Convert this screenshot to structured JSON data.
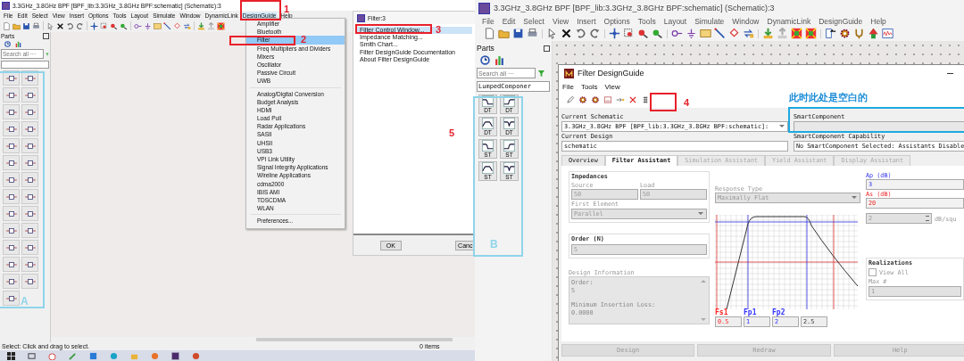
{
  "left": {
    "title": "3.3GHz_3.8GHz BPF [BPF_lib:3.3GHz_3.8GHz BPF:schematic] (Schematic):3",
    "menu": [
      {
        "label": "File",
        "selected": false
      },
      {
        "label": "Edit",
        "selected": false
      },
      {
        "label": "Select",
        "selected": false
      },
      {
        "label": "View",
        "selected": false
      },
      {
        "label": "Insert",
        "selected": false
      },
      {
        "label": "Options",
        "selected": false
      },
      {
        "label": "Tools",
        "selected": false
      },
      {
        "label": "Layout",
        "selected": false
      },
      {
        "label": "Simulate",
        "selected": false
      },
      {
        "label": "Window",
        "selected": false
      },
      {
        "label": "DynamicLink",
        "selected": false
      },
      {
        "label": "DesignGuide",
        "selected": true
      },
      {
        "label": "Help",
        "selected": false
      }
    ],
    "parts": {
      "title": "Parts",
      "search": {
        "placeholder": "Search all ···"
      }
    },
    "design_guide_menu": [
      {
        "items": [
          {
            "label": "Amplifier",
            "selected": false
          },
          {
            "label": "Bluetooth",
            "selected": false
          },
          {
            "label": "Filter",
            "selected": true
          },
          {
            "label": "Freq Multipliers and Dividers",
            "selected": false
          },
          {
            "label": "Mixers",
            "selected": false
          },
          {
            "label": "Oscillator",
            "selected": false
          },
          {
            "label": "Passive Circuit",
            "selected": false
          },
          {
            "label": "UWB",
            "selected": false
          }
        ]
      },
      {
        "items": [
          {
            "label": "Analog/Digital Conversion",
            "selected": false
          },
          {
            "label": "Budget Analysis",
            "selected": false
          },
          {
            "label": "HDMI",
            "selected": false
          },
          {
            "label": "Load Pull",
            "selected": false
          },
          {
            "label": "Radar Applications",
            "selected": false
          },
          {
            "label": "SASII",
            "selected": false
          },
          {
            "label": "UHSII",
            "selected": false
          },
          {
            "label": "USB3",
            "selected": false
          },
          {
            "label": "VPI Link Utility",
            "selected": false
          },
          {
            "label": "Signal Integrity Applications",
            "selected": false
          },
          {
            "label": "Wireline Applications",
            "selected": false
          },
          {
            "label": "cdma2000",
            "selected": false
          },
          {
            "label": "IBIS AMI",
            "selected": false
          },
          {
            "label": "TDSCDMA",
            "selected": false
          },
          {
            "label": "WLAN",
            "selected": false
          }
        ]
      },
      {
        "items": [
          {
            "label": "Preferences...",
            "selected": false
          }
        ]
      }
    ],
    "filter_window": {
      "title": "Filter:3",
      "items": [
        {
          "label": "Filter Control Window...",
          "selected": true
        },
        {
          "label": "Impedance Matching...",
          "selected": false
        },
        {
          "label": "Smith Chart...",
          "selected": false
        },
        {
          "label": "Filter DesignGuide Documentation",
          "selected": false
        },
        {
          "label": "About Filter DesignGuide",
          "selected": false
        }
      ],
      "buttons": [
        "OK",
        "Canc"
      ]
    },
    "status": "Select: Click and drag to select.",
    "item_count": "0 items"
  },
  "right": {
    "title": "3.3GHz_3.8GHz BPF [BPF_lib:3.3GHz_3.8GHz BPF:schematic] (Schematic):3",
    "menu": [
      "File",
      "Edit",
      "Select",
      "View",
      "Insert",
      "Options",
      "Tools",
      "Layout",
      "Simulate",
      "Window",
      "DynamicLink",
      "DesignGuide",
      "Help"
    ],
    "parts": {
      "title": "Parts",
      "search": {
        "placeholder": "Search all ···"
      },
      "library": "LumpedComponer",
      "palette": [
        {
          "label": "DT"
        },
        {
          "label": "DT"
        },
        {
          "label": "DT"
        },
        {
          "label": "DT"
        },
        {
          "label": "ST"
        },
        {
          "label": "ST"
        },
        {
          "label": "ST"
        },
        {
          "label": "ST"
        }
      ]
    },
    "dialog": {
      "title": "Filter DesignGuide",
      "menu": [
        "File",
        "Tools",
        "View"
      ],
      "current_schematic": {
        "label": "Current Schematic",
        "value": "3.3GHz_3.8GHz BPF [BPF_lib:3.3GHz_3.8GHz BPF:schematic]:"
      },
      "smart_component": {
        "label": "SmartComponent"
      },
      "current_design": {
        "label": "Current Design",
        "value": "schematic"
      },
      "capability": {
        "label": "SmartComponent Capability",
        "value": "No SmartComponent Selected: Assistants Disable"
      },
      "tabs": [
        {
          "label": "Overview",
          "selected": false,
          "disabled": false
        },
        {
          "label": "Filter Assistant",
          "selected": true,
          "disabled": false
        },
        {
          "label": "Simulation Assistant",
          "selected": false,
          "disabled": true
        },
        {
          "label": "Yield Assistant",
          "selected": false,
          "disabled": true
        },
        {
          "label": "Display Assistant",
          "selected": false,
          "disabled": true
        }
      ],
      "impedances": {
        "title": "Impedances",
        "source": {
          "label": "Source",
          "value": "50"
        },
        "load": {
          "label": "Load",
          "value": "50"
        },
        "first_element": {
          "label": "First Element",
          "value": "Parallel"
        }
      },
      "order": {
        "title": "Order (N)",
        "value": "5"
      },
      "design_information": {
        "title": "Design Information",
        "lines": [
          "Order:",
          "5",
          "Minimum Insertion Loss:",
          "0.0000"
        ]
      },
      "response_type": {
        "label": "Response Type",
        "value": "Maximally Flat"
      },
      "frequencies": [
        {
          "label": "Fs1",
          "value": "0.5",
          "color": "#ff2020"
        },
        {
          "label": "Fp1",
          "value": "1",
          "color": "#3030ff"
        },
        {
          "label": "Fp2",
          "value": "2",
          "color": "#3030ff"
        },
        {
          "value": "2.5"
        }
      ],
      "ap": {
        "label": "Ap (dB)",
        "value": "3"
      },
      "as": {
        "label": "As (dB)",
        "value": "20"
      },
      "slope": {
        "value": "2",
        "unit": "dB/squ"
      },
      "realizations": {
        "title": "Realizations",
        "view_all": {
          "label": "View All",
          "checked": false
        },
        "max_label": "Max #",
        "max_value": "1"
      },
      "buttons": [
        "Design",
        "Redraw",
        "Help"
      ]
    }
  },
  "annotations": {
    "numbers": [
      "1",
      "2",
      "3",
      "4",
      "5"
    ],
    "areas": [
      "A",
      "B"
    ],
    "note": "此时此处是空白的"
  }
}
